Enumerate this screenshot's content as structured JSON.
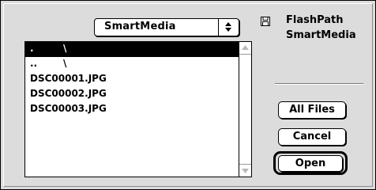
{
  "popup": {
    "label": "SmartMedia"
  },
  "volume": {
    "line1": "FlashPath",
    "line2": "SmartMedia",
    "icon": "disk-icon"
  },
  "files": [
    {
      "name": ".",
      "suffix": "\\",
      "selected": true
    },
    {
      "name": "..",
      "suffix": "\\",
      "selected": false
    },
    {
      "name": "DSC00001.JPG",
      "suffix": "",
      "selected": false
    },
    {
      "name": "DSC00002.JPG",
      "suffix": "",
      "selected": false
    },
    {
      "name": "DSC00003.JPG",
      "suffix": "",
      "selected": false
    }
  ],
  "buttons": {
    "all_files": "All Files",
    "cancel": "Cancel",
    "open": "Open"
  },
  "colors": {
    "selection": "#000000",
    "dialog_bg": "#dcdcdc",
    "list_bg": "#ffffff"
  }
}
